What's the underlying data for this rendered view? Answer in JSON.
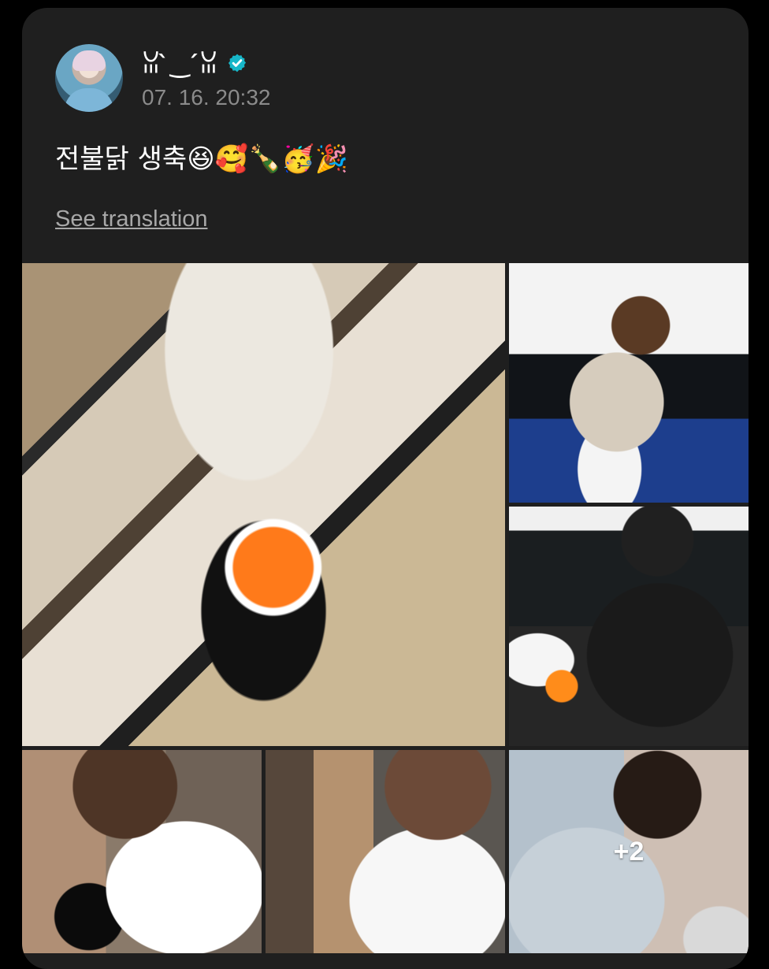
{
  "post": {
    "username": "ꈍ ̀‿ ́ꈍ",
    "timestamp": "07. 16. 20:32",
    "text": "전불닭 생축😆🥰🍾🥳🎉",
    "see_translation": "See translation",
    "more_count": "+2"
  },
  "icons": {
    "verified": "verified-badge-icon"
  },
  "colors": {
    "background": "#000000",
    "card": "#1f1f1f",
    "text_primary": "#ffffff",
    "text_secondary": "#8b8b8b",
    "verified": "#17b6c8"
  }
}
